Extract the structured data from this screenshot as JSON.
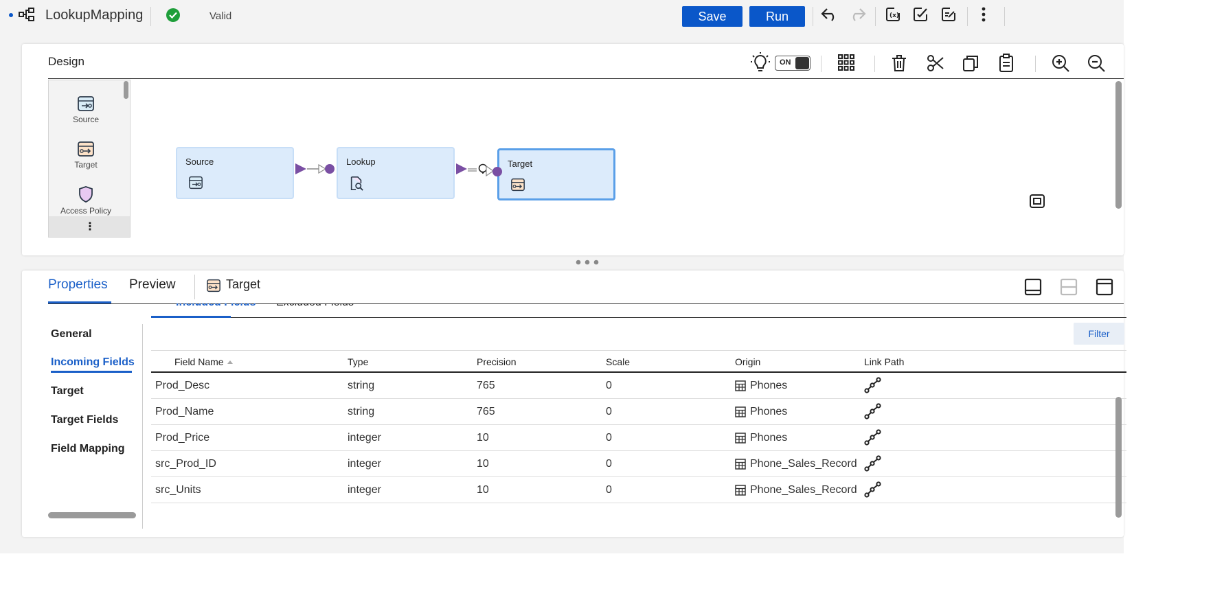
{
  "header": {
    "title": "LookupMapping",
    "status": "Valid",
    "save_label": "Save",
    "run_label": "Run",
    "icons": [
      "mapping-icon",
      "valid-check-icon",
      "undo-icon",
      "redo-icon",
      "parameters-icon",
      "validate-icon",
      "edit-summary-icon",
      "more-icon"
    ]
  },
  "design": {
    "label": "Design",
    "toggle_label": "ON",
    "toolbar_icons": [
      "lightbulb-icon",
      "arrange-grid-icon",
      "delete-icon",
      "cut-icon",
      "copy-icon",
      "paste-icon",
      "zoom-in-icon",
      "zoom-out-icon"
    ],
    "palette": [
      {
        "label": "Source",
        "icon": "source-icon"
      },
      {
        "label": "Target",
        "icon": "target-icon"
      },
      {
        "label": "Access Policy",
        "icon": "shield-icon"
      }
    ],
    "palette_more": "⋮",
    "nodes": [
      {
        "label": "Source",
        "icon": "source-icon"
      },
      {
        "label": "Lookup",
        "icon": "lookup-icon"
      },
      {
        "label": "Target",
        "icon": "target-icon",
        "selected": true
      }
    ]
  },
  "properties": {
    "tabs": [
      "Properties",
      "Preview"
    ],
    "selected_object": "Target",
    "sidebar": [
      "General",
      "Incoming Fields",
      "Target",
      "Target Fields",
      "Field Mapping"
    ],
    "active_sidebar": "Incoming Fields",
    "subtabs": [
      "Included Fields",
      "Excluded Fields"
    ],
    "filter_label": "Filter",
    "columns": [
      "Field Name",
      "Type",
      "Precision",
      "Scale",
      "Origin",
      "Link Path"
    ],
    "rows": [
      {
        "name": "Prod_Desc",
        "type": "string",
        "precision": "765",
        "scale": "0",
        "origin": "Phones"
      },
      {
        "name": "Prod_Name",
        "type": "string",
        "precision": "765",
        "scale": "0",
        "origin": "Phones"
      },
      {
        "name": "Prod_Price",
        "type": "integer",
        "precision": "10",
        "scale": "0",
        "origin": "Phones"
      },
      {
        "name": "src_Prod_ID",
        "type": "integer",
        "precision": "10",
        "scale": "0",
        "origin": "Phone_Sales_Record"
      },
      {
        "name": "src_Units",
        "type": "integer",
        "precision": "10",
        "scale": "0",
        "origin": "Phone_Sales_Record"
      }
    ]
  },
  "colors": {
    "accent": "#0a57c9",
    "link_blue": "#1a5fc8",
    "node_fill": "#dcebfb",
    "port_purple": "#7a4fa3",
    "valid_green": "#1e9e3a"
  }
}
